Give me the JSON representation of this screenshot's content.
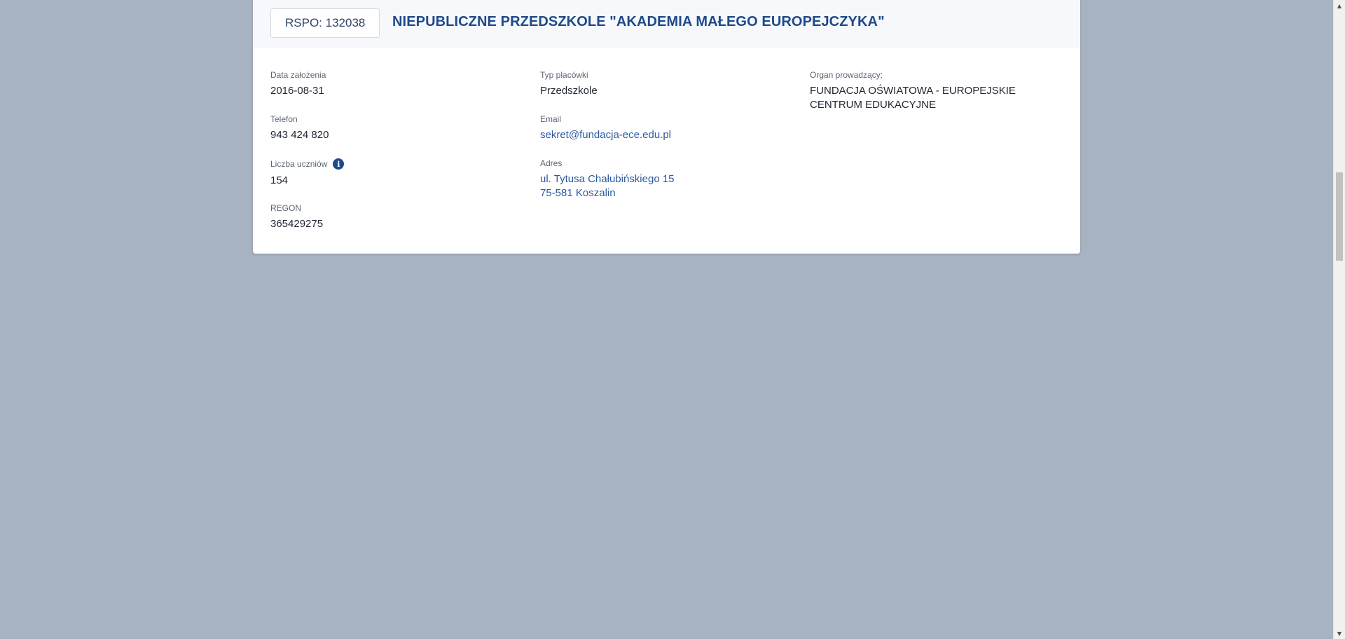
{
  "header": {
    "rspo": "RSPO: 132038",
    "title": "NIEPUBLICZNE PRZEDSZKOLE \"AKADEMIA MAŁEGO EUROPEJCZYKA\""
  },
  "fields": {
    "founded": {
      "label": "Data założenia",
      "value": "2016-08-31"
    },
    "phone": {
      "label": "Telefon",
      "value": "943 424 820"
    },
    "students": {
      "label": "Liczba uczniów",
      "value": "154",
      "icon": "info-icon"
    },
    "regon": {
      "label": "REGON",
      "value": "365429275"
    },
    "type": {
      "label": "Typ placówki",
      "value": "Przedszkole"
    },
    "email": {
      "label": "Email",
      "value": "sekret@fundacja-ece.edu.pl"
    },
    "address": {
      "label": "Adres",
      "line1": "ul. Tytusa Chałubińskiego 15",
      "line2": "75-581 Koszalin"
    },
    "organ": {
      "label": "Organ prowadzący:",
      "value": "FUNDACJA OŚWIATOWA - EUROPEJSKIE CENTRUM EDUKACYJNE"
    }
  },
  "colors": {
    "page_background": "#a8b3c1",
    "title": "#1f4a8a",
    "link": "#2c5aa0"
  }
}
